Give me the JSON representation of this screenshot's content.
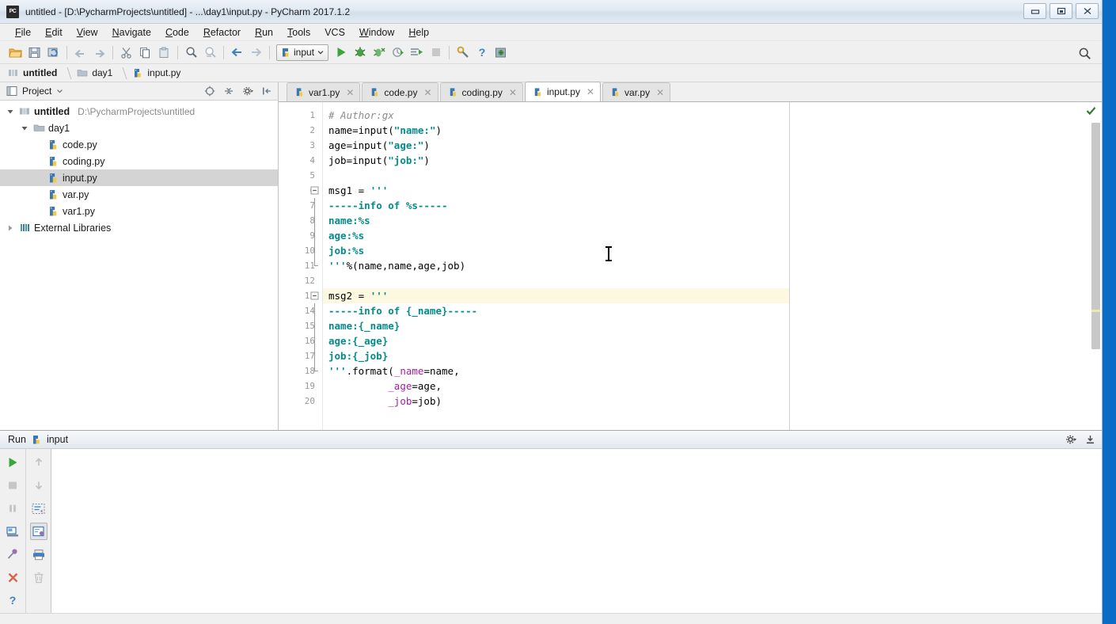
{
  "window": {
    "title": "untitled - [D:\\PycharmProjects\\untitled] - ...\\day1\\input.py - PyCharm 2017.1.2",
    "logo": "PC",
    "controls": [
      {
        "name": "minimize-button",
        "icon": "minimize-icon"
      },
      {
        "name": "maximize-button",
        "icon": "maximize-icon"
      },
      {
        "name": "close-button",
        "icon": "close-icon"
      }
    ]
  },
  "menubar": {
    "items": [
      {
        "label": "File",
        "mnemonic": "F"
      },
      {
        "label": "Edit",
        "mnemonic": "E"
      },
      {
        "label": "View",
        "mnemonic": "V"
      },
      {
        "label": "Navigate",
        "mnemonic": "N"
      },
      {
        "label": "Code",
        "mnemonic": "C"
      },
      {
        "label": "Refactor",
        "mnemonic": "R"
      },
      {
        "label": "Run",
        "mnemonic": "R"
      },
      {
        "label": "Tools",
        "mnemonic": "T"
      },
      {
        "label": "VCS",
        "mnemonic": ""
      },
      {
        "label": "Window",
        "mnemonic": "W"
      },
      {
        "label": "Help",
        "mnemonic": "H"
      }
    ]
  },
  "toolbar": {
    "icons": [
      "open-folder-icon",
      "save-all-icon",
      "sync-refresh-icon",
      "undo-arrow-icon",
      "redo-arrow-icon",
      "cut-scissors-icon",
      "copy-icon",
      "paste-icon",
      "find-magnifier-icon",
      "replace-icon",
      "back-arrow-icon",
      "forward-arrow-icon"
    ],
    "run_config": {
      "label": "input",
      "icon": "python-config-icon",
      "dropdown_icon": "chevron-down-icon"
    },
    "run_icons": [
      "run-play-icon",
      "debug-bug-icon",
      "coverage-icon",
      "profile-icon",
      "run-with-console-icon",
      "stop-icon"
    ],
    "right_icons": [
      "settings-wrench-icon",
      "help-question-icon",
      "update-icon"
    ],
    "search_icon": "search-magnifier-icon"
  },
  "breadcrumb": {
    "items": [
      {
        "label": "untitled",
        "icon": "module-icon"
      },
      {
        "label": "day1",
        "icon": "folder-icon"
      },
      {
        "label": "input.py",
        "icon": "python-file-icon"
      }
    ]
  },
  "project_panel": {
    "title": "Project",
    "dropdown_icon": "chevron-down-icon",
    "toolbar_icons": [
      "locate-target-icon",
      "collapse-all-icon",
      "gear-settings-icon",
      "hide-panel-icon"
    ],
    "tree": [
      {
        "label": "untitled",
        "path": "D:\\PycharmProjects\\untitled",
        "icon": "module-icon",
        "twisty": "expanded",
        "depth": 0,
        "bold": true,
        "selected": false
      },
      {
        "label": "day1",
        "path": "",
        "icon": "folder-icon",
        "twisty": "expanded",
        "depth": 1,
        "bold": false,
        "selected": false
      },
      {
        "label": "code.py",
        "path": "",
        "icon": "python-file-icon",
        "twisty": "none",
        "depth": 2,
        "bold": false,
        "selected": false
      },
      {
        "label": "coding.py",
        "path": "",
        "icon": "python-file-icon",
        "twisty": "none",
        "depth": 2,
        "bold": false,
        "selected": false
      },
      {
        "label": "input.py",
        "path": "",
        "icon": "python-file-icon",
        "twisty": "none",
        "depth": 2,
        "bold": false,
        "selected": true
      },
      {
        "label": "var.py",
        "path": "",
        "icon": "python-file-icon",
        "twisty": "none",
        "depth": 2,
        "bold": false,
        "selected": false
      },
      {
        "label": "var1.py",
        "path": "",
        "icon": "python-file-icon",
        "twisty": "none",
        "depth": 2,
        "bold": false,
        "selected": false
      },
      {
        "label": "External Libraries",
        "path": "",
        "icon": "libraries-icon",
        "twisty": "collapsed",
        "depth": 0,
        "bold": false,
        "selected": false
      }
    ]
  },
  "editor": {
    "tabs": [
      {
        "label": "var1.py",
        "icon": "python-file-icon",
        "active": false,
        "close_icon": "close-icon"
      },
      {
        "label": "code.py",
        "icon": "python-file-icon",
        "active": false,
        "close_icon": "close-icon"
      },
      {
        "label": "coding.py",
        "icon": "python-file-icon",
        "active": false,
        "close_icon": "close-icon"
      },
      {
        "label": "input.py",
        "icon": "python-file-icon",
        "active": true,
        "close_icon": "close-icon"
      },
      {
        "label": "var.py",
        "icon": "python-file-icon",
        "active": false,
        "close_icon": "close-icon"
      }
    ],
    "inspection_status_icon": "checkmark-ok-icon",
    "caret_line": 13,
    "lines": [
      {
        "n": 1,
        "fold": "none",
        "tokens": [
          {
            "t": "# Author:gx",
            "c": "com"
          }
        ]
      },
      {
        "n": 2,
        "fold": "none",
        "tokens": [
          {
            "t": "name=input(",
            "c": ""
          },
          {
            "t": "\"name:\"",
            "c": "str"
          },
          {
            "t": ")",
            "c": ""
          }
        ]
      },
      {
        "n": 3,
        "fold": "none",
        "tokens": [
          {
            "t": "age=input(",
            "c": ""
          },
          {
            "t": "\"age:\"",
            "c": "str"
          },
          {
            "t": ")",
            "c": ""
          }
        ]
      },
      {
        "n": 4,
        "fold": "none",
        "tokens": [
          {
            "t": "job=input(",
            "c": ""
          },
          {
            "t": "\"job:\"",
            "c": "str"
          },
          {
            "t": ")",
            "c": ""
          }
        ]
      },
      {
        "n": 5,
        "fold": "none",
        "tokens": [
          {
            "t": "",
            "c": ""
          }
        ]
      },
      {
        "n": 6,
        "fold": "start",
        "tokens": [
          {
            "t": "msg1 = ",
            "c": ""
          },
          {
            "t": "'''",
            "c": "str"
          }
        ]
      },
      {
        "n": 7,
        "fold": "mid",
        "tokens": [
          {
            "t": "-----info of %s-----",
            "c": "str"
          }
        ]
      },
      {
        "n": 8,
        "fold": "mid",
        "tokens": [
          {
            "t": "name:%s",
            "c": "str"
          }
        ]
      },
      {
        "n": 9,
        "fold": "mid",
        "tokens": [
          {
            "t": "age:%s",
            "c": "str"
          }
        ]
      },
      {
        "n": 10,
        "fold": "mid",
        "tokens": [
          {
            "t": "job:%s",
            "c": "str"
          }
        ]
      },
      {
        "n": 11,
        "fold": "end",
        "tokens": [
          {
            "t": "'''",
            "c": "str"
          },
          {
            "t": "%(name,name,age,job)",
            "c": ""
          }
        ]
      },
      {
        "n": 12,
        "fold": "none",
        "tokens": [
          {
            "t": "",
            "c": ""
          }
        ]
      },
      {
        "n": 13,
        "fold": "start",
        "tokens": [
          {
            "t": "msg2 = ",
            "c": ""
          },
          {
            "t": "'''",
            "c": "str"
          }
        ]
      },
      {
        "n": 14,
        "fold": "mid",
        "tokens": [
          {
            "t": "-----info of {_name}-----",
            "c": "str"
          }
        ]
      },
      {
        "n": 15,
        "fold": "mid",
        "tokens": [
          {
            "t": "name:{_name}",
            "c": "str"
          }
        ]
      },
      {
        "n": 16,
        "fold": "mid",
        "tokens": [
          {
            "t": "age:{_age}",
            "c": "str"
          }
        ]
      },
      {
        "n": 17,
        "fold": "mid",
        "tokens": [
          {
            "t": "job:{_job}",
            "c": "str"
          }
        ]
      },
      {
        "n": 18,
        "fold": "end",
        "tokens": [
          {
            "t": "'''",
            "c": "str"
          },
          {
            "t": ".format(",
            "c": ""
          },
          {
            "t": "_name",
            "c": "kwarg"
          },
          {
            "t": "=name,",
            "c": ""
          }
        ]
      },
      {
        "n": 19,
        "fold": "none",
        "tokens": [
          {
            "t": "          ",
            "c": ""
          },
          {
            "t": "_age",
            "c": "kwarg"
          },
          {
            "t": "=age,",
            "c": ""
          }
        ]
      },
      {
        "n": 20,
        "fold": "none",
        "tokens": [
          {
            "t": "          ",
            "c": ""
          },
          {
            "t": "_job",
            "c": "kwarg"
          },
          {
            "t": "=job)",
            "c": ""
          }
        ]
      }
    ]
  },
  "run_panel": {
    "title": "Run",
    "config_name": "input",
    "config_icon": "python-config-icon",
    "header_icons": [
      "gear-settings-icon",
      "hide-panel-icon"
    ],
    "left_tool_icons": [
      "rerun-play-icon",
      "stop-icon",
      "pause-icon",
      "console-icon",
      "pin-tab-icon",
      "close-x-icon",
      "help-question-icon"
    ],
    "right_tool_icons": [
      "scroll-up-icon",
      "scroll-down-icon",
      "soft-wrap-icon",
      "scroll-to-end-icon",
      "print-icon",
      "trash-icon"
    ],
    "console_text": ""
  },
  "colors": {
    "accent_blue": "#0a6cc4",
    "string_teal": "#058b8c",
    "comment_gray": "#8c8c8c",
    "kwarg_purple": "#a020a0",
    "caret_line_yellow": "#fcf9e0",
    "selection_gray": "#d4d4d4",
    "run_green": "#3ba53b"
  }
}
